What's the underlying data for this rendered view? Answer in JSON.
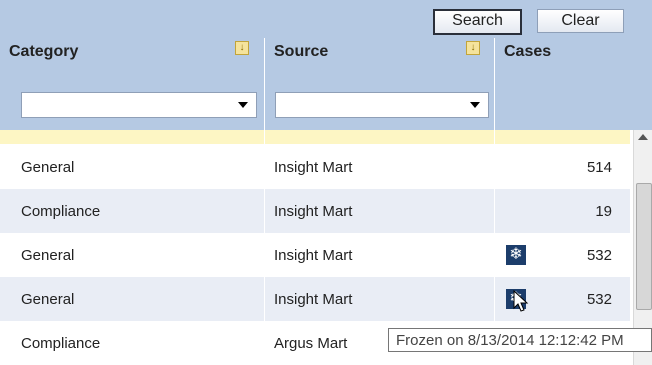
{
  "toolbar": {
    "search_label": "Search",
    "clear_label": "Clear"
  },
  "columns": [
    {
      "title": "Category",
      "filter_value": ""
    },
    {
      "title": "Source",
      "filter_value": ""
    },
    {
      "title": "Cases"
    }
  ],
  "rows": [
    {
      "category": "General",
      "source": "Insight Mart",
      "cases": "514",
      "frozen": false
    },
    {
      "category": "Compliance",
      "source": "Insight Mart",
      "cases": "19",
      "frozen": false
    },
    {
      "category": "General",
      "source": "Insight Mart",
      "cases": "532",
      "frozen": true
    },
    {
      "category": "General",
      "source": "Insight Mart",
      "cases": "532",
      "frozen": true
    },
    {
      "category": "Compliance",
      "source": "Argus Mart",
      "cases": "",
      "frozen": false
    }
  ],
  "tooltip": {
    "text": "Frozen on 8/13/2014 12:12:42 PM"
  },
  "icons": {
    "sort": "sort-down-icon",
    "frozen": "snowflake-icon"
  },
  "colors": {
    "header_bg": "#b5c9e3",
    "alt_row": "#e9edf5",
    "highlight_row": "#fdf6c4",
    "frozen_icon": "#1c3d6b"
  }
}
